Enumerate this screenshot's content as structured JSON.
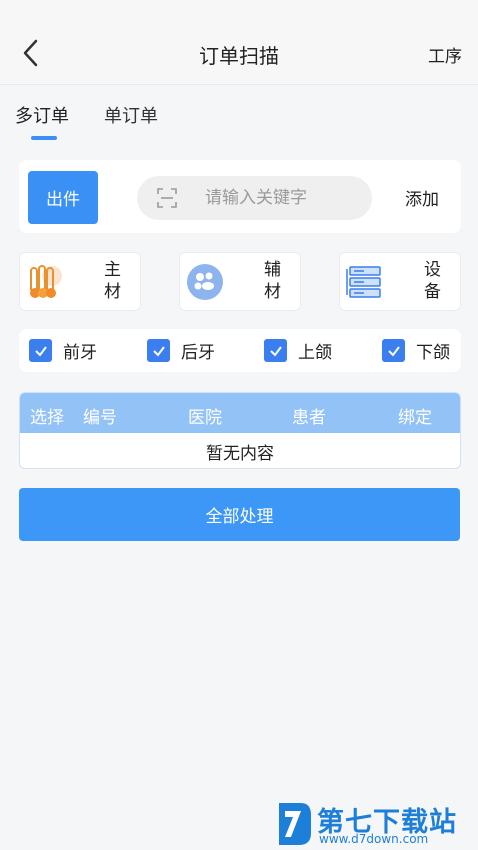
{
  "header": {
    "title": "订单扫描",
    "right_action": "工序",
    "back_icon": "chevron-left-icon"
  },
  "tabs": [
    {
      "label": "多订单",
      "active": true
    },
    {
      "label": "单订单",
      "active": false
    }
  ],
  "search": {
    "out_button": "出件",
    "placeholder": "请输入关键字",
    "value": "",
    "add_button": "添加",
    "scan_icon": "scan-icon"
  },
  "materials": [
    {
      "label": "主材",
      "icon": "main-material-icon"
    },
    {
      "label": "辅材",
      "icon": "auxiliary-material-icon"
    },
    {
      "label": "设备",
      "icon": "device-icon"
    }
  ],
  "checkboxes": [
    {
      "label": "前牙",
      "checked": true
    },
    {
      "label": "后牙",
      "checked": true
    },
    {
      "label": "上颌",
      "checked": true
    },
    {
      "label": "下颌",
      "checked": true
    }
  ],
  "table": {
    "columns": [
      "选择",
      "编号",
      "医院",
      "患者",
      "绑定"
    ],
    "empty_text": "暂无内容"
  },
  "process_button": "全部处理",
  "watermark": {
    "name": "第七下载站",
    "url": "www.d7down.com"
  },
  "colors": {
    "accent": "#3a90f5",
    "table_header": "#93c2f6",
    "watermark": "#1e7fd8"
  }
}
